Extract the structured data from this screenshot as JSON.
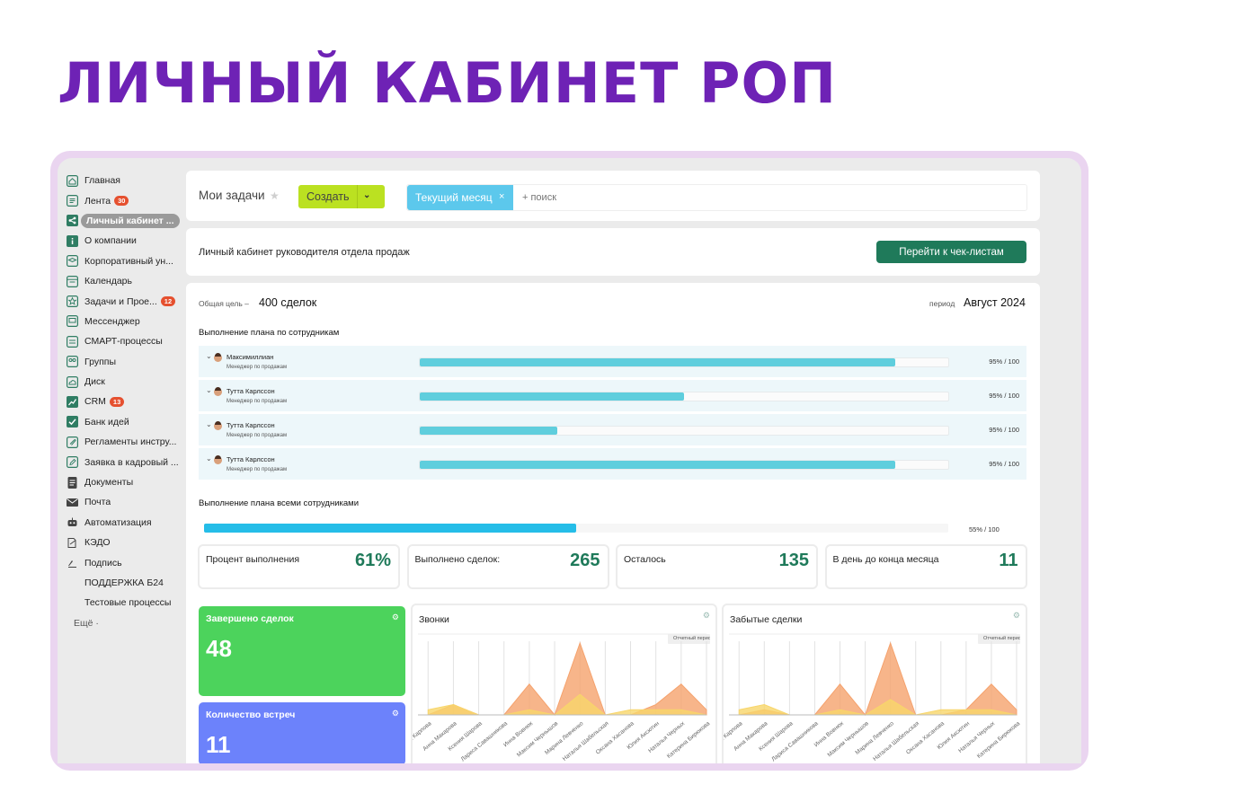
{
  "headline": "ЛИЧНЫЙ КАБИНЕТ РОП",
  "sidebar": {
    "items": [
      {
        "label": "Главная",
        "icon": "home-icon"
      },
      {
        "label": "Лента",
        "icon": "feed-icon",
        "badge": "30"
      },
      {
        "label": "Личный кабинет ...",
        "icon": "share-icon",
        "active": true
      },
      {
        "label": "О компании",
        "icon": "info-icon"
      },
      {
        "label": "Корпоративный ун...",
        "icon": "graduation-icon"
      },
      {
        "label": "Календарь",
        "icon": "calendar-icon"
      },
      {
        "label": "Задачи и Прое...",
        "icon": "star-icon",
        "badge": "12"
      },
      {
        "label": "Мессенджер",
        "icon": "chat-icon"
      },
      {
        "label": "СМАРТ-процессы",
        "icon": "process-icon"
      },
      {
        "label": "Группы",
        "icon": "groups-icon"
      },
      {
        "label": "Диск",
        "icon": "cloud-icon"
      },
      {
        "label": "CRM",
        "icon": "chart-icon",
        "badge": "13"
      },
      {
        "label": "Банк идей",
        "icon": "check-icon"
      },
      {
        "label": "Регламенты инстру...",
        "icon": "attach-icon"
      },
      {
        "label": "Заявка в кадровый ...",
        "icon": "edit-icon"
      },
      {
        "label": "Документы",
        "icon": "document-icon"
      },
      {
        "label": "Почта",
        "icon": "mail-icon"
      },
      {
        "label": "Автоматизация",
        "icon": "robot-icon"
      },
      {
        "label": "КЭДО",
        "icon": "sign-doc-icon"
      },
      {
        "label": "Подпись",
        "icon": "signature-icon"
      },
      {
        "label": "ПОДДЕРЖКА Б24",
        "icon": ""
      },
      {
        "label": "Тестовые процессы",
        "icon": ""
      }
    ],
    "more_label": "Ещё ·"
  },
  "topbar": {
    "title": "Мои задачи",
    "create_label": "Создать",
    "filter_tag": "Текущий месяц",
    "search_placeholder": "+ поиск"
  },
  "header": {
    "text": "Личный кабинет руководителя отдела продаж",
    "button": "Перейти к чек-листам"
  },
  "goal": {
    "label": "Общая цель –",
    "value": "400 сделок"
  },
  "period": {
    "label": "период",
    "value": "Август 2024"
  },
  "employees_title": "Выполнение плана по сотрудникам",
  "employees": [
    {
      "name": "Максимиллиан",
      "role": "Менеджер по продажам",
      "progress": 0.9,
      "score": "95% / 100"
    },
    {
      "name": "Тутта Карлссон",
      "role": "Менеджер по продажам",
      "progress": 0.5,
      "score": "95% / 100"
    },
    {
      "name": "Тутта Карлссон",
      "role": "Менеджер по продажам",
      "progress": 0.26,
      "score": "95% / 100"
    },
    {
      "name": "Тутта Карлссон",
      "role": "Менеджер по продажам",
      "progress": 0.9,
      "score": "95% / 100"
    }
  ],
  "all_title": "Выполнение плана всеми сотрудниками",
  "all_progress": {
    "progress": 0.5,
    "score": "55% / 100"
  },
  "kpis": [
    {
      "label": "Процент выполнения",
      "value": "61%"
    },
    {
      "label": "Выполнено сделок:",
      "value": "265"
    },
    {
      "label": "Осталось",
      "value": "135"
    },
    {
      "label": "В день до конца месяца",
      "value": "11"
    }
  ],
  "tiles": [
    {
      "label": "Завершено сделок",
      "value": "48",
      "color": "#4cd35c"
    },
    {
      "label": "Количество встреч",
      "value": "11",
      "color": "#6c82fb"
    }
  ],
  "charts": [
    {
      "title": "Звонки",
      "tag": "Отчетный период"
    },
    {
      "title": "Забытые сделки",
      "tag": "Отчетный период"
    }
  ],
  "chart_data": [
    {
      "type": "area",
      "title": "Звонки",
      "categories": [
        "на Карпова",
        "Анна Макарова",
        "Ксения Шарова",
        "Лариса Савашникова",
        "Инна Вовнюк",
        "Максим Чернышов",
        "Марина Левченко",
        "Наталья Шабельская",
        "Оксана Хасанова",
        "Юлия Аксютин",
        "Наталья Черных",
        "Катерина Бирюкова"
      ],
      "series": [
        {
          "values": [
            0,
            2,
            0,
            0,
            6,
            0,
            14,
            0,
            0,
            2,
            6,
            1
          ],
          "color": "#f5a26d"
        },
        {
          "values": [
            1,
            2,
            0,
            0,
            1,
            0,
            4,
            0,
            1,
            1,
            1,
            0
          ],
          "color": "#f8d66a"
        }
      ]
    },
    {
      "type": "area",
      "title": "Забытые сделки",
      "categories": [
        "на Карпова",
        "Анна Макарова",
        "Ксения Шарова",
        "Лариса Савашникова",
        "Инна Вовнюк",
        "Максим Чернышов",
        "Марина Левченко",
        "Наталья Шабельская",
        "Оксана Хасанова",
        "Юлия Аксютин",
        "Наталья Черных",
        "Катерина Бирюкова"
      ],
      "series": [
        {
          "values": [
            0,
            1,
            0,
            0,
            6,
            0,
            14,
            0,
            0,
            1,
            6,
            1
          ],
          "color": "#f5a26d"
        },
        {
          "values": [
            1,
            2,
            0,
            0,
            1,
            0,
            3,
            0,
            1,
            1,
            1,
            0
          ],
          "color": "#f8d66a"
        }
      ]
    }
  ],
  "colors": {
    "headline": "#6e22b5",
    "accent_green": "#1f7a5a",
    "create_button": "#bbe121",
    "filter_tag": "#5cc8ec",
    "employee_bar": "#5fcedd",
    "total_bar": "#25bde8"
  }
}
